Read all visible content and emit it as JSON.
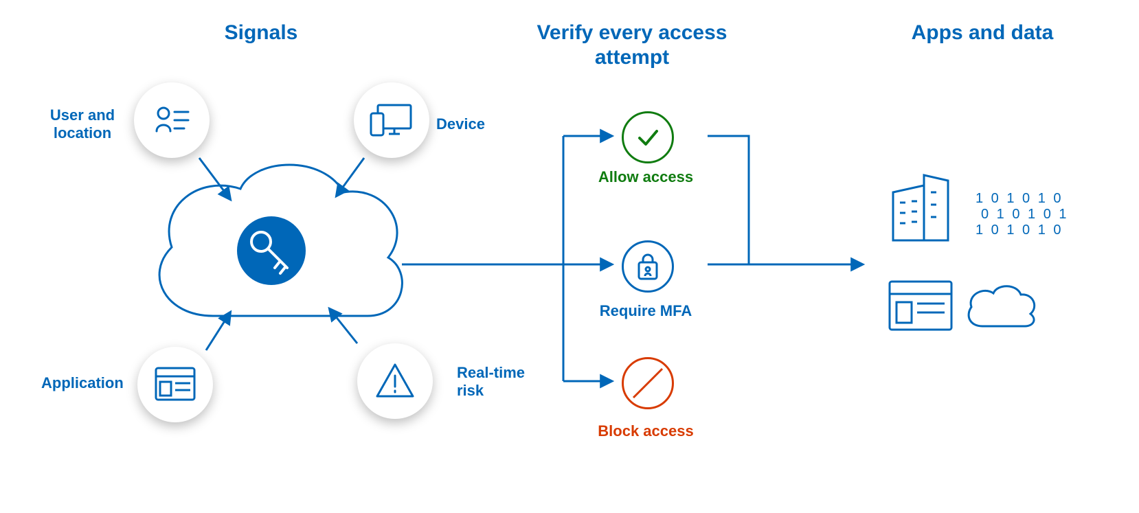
{
  "headings": {
    "signals": "Signals",
    "verify": "Verify every access attempt",
    "apps": "Apps and data"
  },
  "signals": {
    "user_location": "User and location",
    "device": "Device",
    "application": "Application",
    "realtime_risk": "Real-time risk"
  },
  "decisions": {
    "allow": "Allow access",
    "mfa": "Require MFA",
    "block": "Block access"
  },
  "apps": {
    "binary": "101010 010101 101010"
  },
  "colors": {
    "blue": "#0067B8",
    "green": "#107C10",
    "red": "#D83B01"
  }
}
